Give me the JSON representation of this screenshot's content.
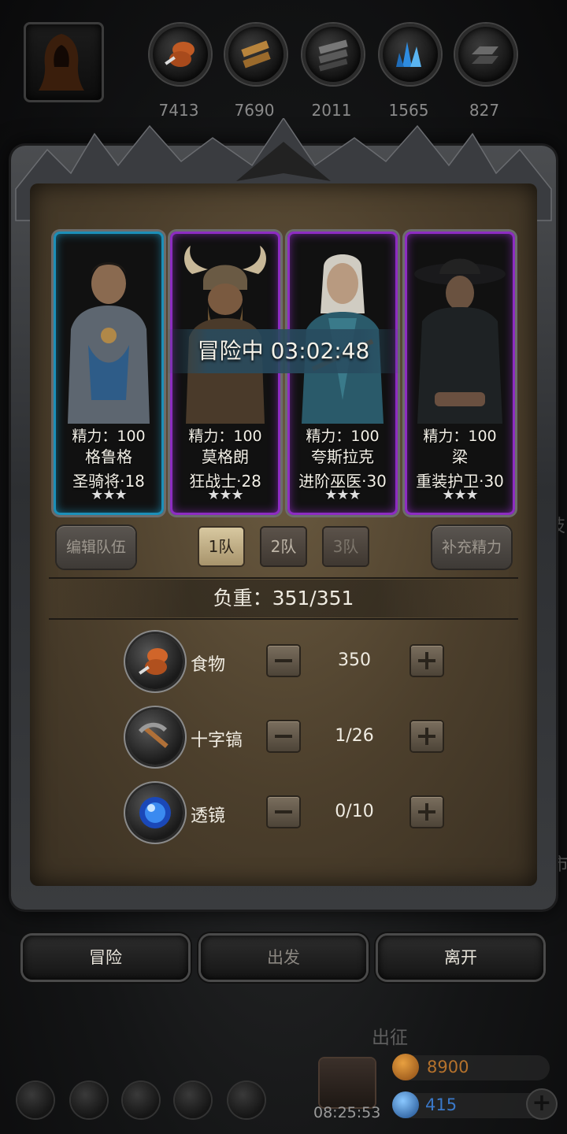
{
  "resources": [
    {
      "icon": "meat-icon",
      "count": "7413"
    },
    {
      "icon": "wood-icon",
      "count": "7690"
    },
    {
      "icon": "iron-icon",
      "count": "2011"
    },
    {
      "icon": "crystal-icon",
      "count": "1565"
    },
    {
      "icon": "ingot-icon",
      "count": "827"
    }
  ],
  "adventure_timer": "冒险中 03:02:48",
  "heroes": [
    {
      "energy": "精力：100",
      "name": "格鲁格",
      "class_level": "圣骑将·18",
      "stars": "★★★",
      "rarity": "blue"
    },
    {
      "energy": "精力：100",
      "name": "莫格朗",
      "class_level": "狂战士·28",
      "stars": "★★★",
      "rarity": "purple"
    },
    {
      "energy": "精力：100",
      "name": "夸斯拉克",
      "class_level": "进阶巫医·30",
      "stars": "★★★",
      "rarity": "purple"
    },
    {
      "energy": "精力：100",
      "name": "梁",
      "class_level": "重装护卫·30",
      "stars": "★★★",
      "rarity": "purple"
    }
  ],
  "team_controls": {
    "edit_team": "编辑队伍",
    "teams": [
      "1队",
      "2队",
      "3队"
    ],
    "refill_energy": "补充精力"
  },
  "load": "负重：351/351",
  "supplies": [
    {
      "icon": "food-icon",
      "name": "食物",
      "value": "350"
    },
    {
      "icon": "pickaxe-icon",
      "name": "十字镐",
      "value": "1/26"
    },
    {
      "icon": "lens-icon",
      "name": "透镜",
      "value": "0/10"
    }
  ],
  "actions": {
    "adventure": "冒险",
    "depart": "出发",
    "leave": "离开"
  },
  "bottom": {
    "expedition_label": "出征",
    "gift_timer": "08:25:53",
    "gold": "8900",
    "gems": "415",
    "side_text_1": "技",
    "side_text_2": "市"
  },
  "colors": {
    "blue_frame": "#1c8fb8",
    "purple_frame": "#8d2cc2",
    "gold_text": "#b5722c",
    "gem_text": "#3a78c8"
  }
}
